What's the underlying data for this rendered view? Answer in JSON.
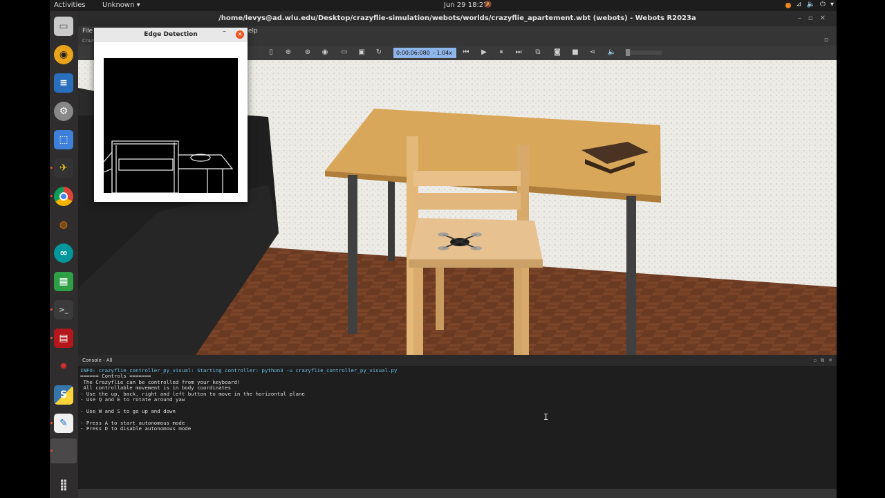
{
  "topbar": {
    "activities": "Activities",
    "app_menu": "Unknown ▾",
    "clock": "Jun 29  18:27"
  },
  "window": {
    "title": "/home/levys@ad.wlu.edu/Desktop/crazyflie-simulation/webots/worlds/crazyflie_apartement.wbt (webots) - Webots R2023a",
    "menu_file": "File",
    "menu_help": "elp",
    "scene_tab": "Crazy"
  },
  "toolbar": {
    "sim_time": "0:00:06:080",
    "speed": "- 1.04x"
  },
  "edge_window": {
    "title": "Edge Detection"
  },
  "console": {
    "header": "Console - All",
    "lines": [
      "INFO: crazyflie_controller_py_visual: Starting controller: python3 -u crazyflie_controller_py_visual.py",
      "====== Controls =======",
      " The Crazyflie can be controlled from your keyboard!",
      " All controllable movement is in body coordinates",
      "- Use the up, back, right and left button to move in the horizontal plane",
      "- Use Q and E to rotate around yaw",
      "",
      "- Use W and S to go up and down",
      "",
      "- Press A to start autonomous mode",
      "- Press D to disable autonomous mode"
    ]
  },
  "colors": {
    "accent": "#e95420",
    "time_box": "#8fb6e9",
    "console_info": "#6ec1e4"
  },
  "icons": {
    "dock": [
      "files-icon",
      "rhythmbox-icon",
      "writer-icon",
      "settings-icon",
      "screenshot-icon",
      "webots-icon",
      "chrome-icon",
      "blender-icon",
      "arduino-icon",
      "calc-icon",
      "terminal-icon",
      "red-app-icon",
      "bug-icon",
      "python-icon",
      "text-editor-icon",
      "blank-app-icon",
      "show-apps-icon"
    ]
  }
}
